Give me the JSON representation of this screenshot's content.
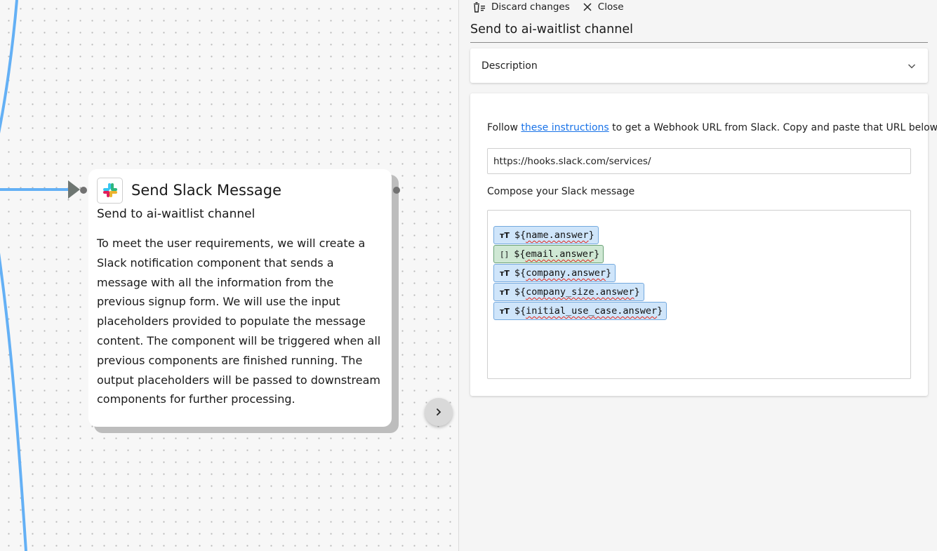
{
  "node": {
    "title": "Send Slack Message",
    "subtitle": "Send to ai-waitlist channel",
    "description": "To meet the user requirements, we will create a Slack notification component that sends a message with all the information from the previous signup form. We will use the input placeholders provided to populate the message content. The component will be triggered when all previous components are finished running. The output placeholders will be passed to downstream components for further processing.",
    "icon": "slack-icon"
  },
  "toolbar": {
    "discard_label": "Discard changes",
    "close_label": "Close"
  },
  "panel": {
    "title": "Send to ai-waitlist channel",
    "description_label": "Description",
    "instructions_prefix": "Follow ",
    "instructions_link": "these instructions",
    "instructions_suffix": " to get a Webhook URL from Slack. Copy and paste that URL below",
    "webhook_value": "https://hooks.slack.com/services/",
    "compose_label": "Compose your Slack message",
    "tokens": [
      {
        "icon": "ᴛT",
        "prefix": "${",
        "var": "name.answer",
        "suffix": "}",
        "kind": "text"
      },
      {
        "icon": "[]",
        "prefix": "${",
        "var": "email.answer",
        "suffix": "}",
        "kind": "list"
      },
      {
        "icon": "ᴛT",
        "prefix": "${",
        "var": "company.answer",
        "suffix": "}",
        "kind": "text"
      },
      {
        "icon": "ᴛT",
        "prefix": "${",
        "var": "company_size.answer",
        "suffix": "}",
        "kind": "text"
      },
      {
        "icon": "ᴛT",
        "prefix": "${",
        "var": "initial_use_case.answer",
        "suffix": "}",
        "kind": "text"
      }
    ]
  },
  "colors": {
    "edge": "#64b0f5",
    "link": "#1a73e8",
    "token_text_bg": "#cfe5fa",
    "token_list_bg": "#cfe8d4"
  }
}
